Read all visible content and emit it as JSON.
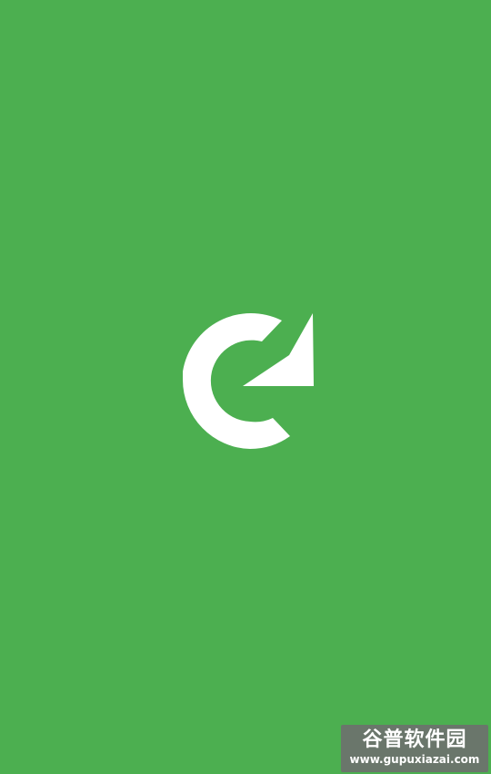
{
  "screen": {
    "background_color": "#4caf50",
    "icon": "refresh-icon",
    "icon_color": "#ffffff"
  },
  "watermark": {
    "logo_text": "谷普软件园",
    "url_text": "www.gupuxiazai.com"
  }
}
